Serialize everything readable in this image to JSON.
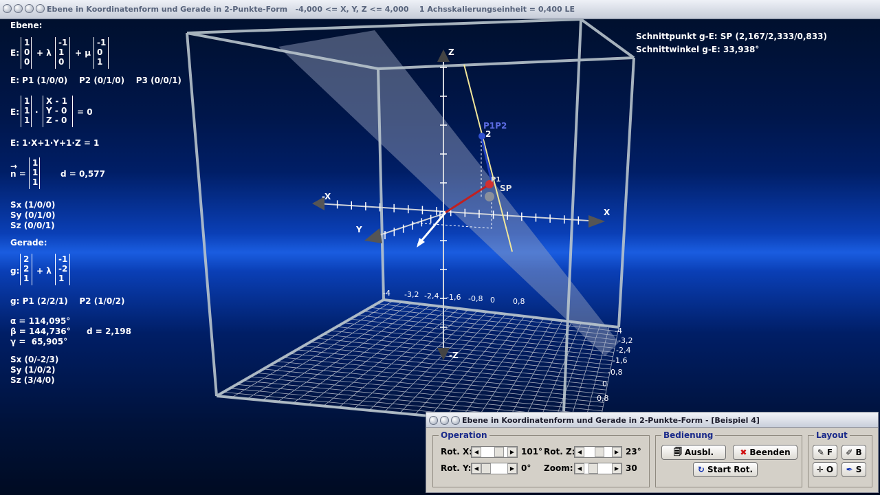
{
  "window": {
    "title": "Ebene in Koordinatenform und Gerade in 2-Punkte-Form   -4,000 <= X, Y, Z <= 4,000    1 Achsskalierungseinheit = 0,400 LE"
  },
  "left_info": {
    "ebene_heading": "Ebene:",
    "e_prefix": "E:",
    "e_vec1": [
      "1",
      "0",
      "0"
    ],
    "plus_lambda": "+ λ",
    "e_vec2": [
      "-1",
      "1",
      "0"
    ],
    "plus_mu": "+ μ",
    "e_vec3": [
      "-1",
      "0",
      "1"
    ],
    "e_points": "E: P1 (1/0/0)    P2 (0/1/0)    P3 (0/0/1)",
    "e_normal_vec": [
      "1",
      "1",
      "1"
    ],
    "dot": "·",
    "e_xyz_vec": [
      "X - 1",
      "Y - 0",
      "Z - 0"
    ],
    "eq_zero": "= 0",
    "e_coord": "E: 1·X+1·Y+1·Z = 1",
    "n_arrow": "→",
    "n_label": "n =",
    "n_vec": [
      "1",
      "1",
      "1"
    ],
    "d_plane": "d = 0,577",
    "sx": "Sx (1/0/0)",
    "sy": "Sy (0/1/0)",
    "sz": "Sz (0/0/1)",
    "gerade_heading": "Gerade:",
    "g_prefix": "g:",
    "g_vec1": [
      "2",
      "2",
      "1"
    ],
    "g_plus_lambda": "+ λ",
    "g_vec2": [
      "-1",
      "-2",
      "1"
    ],
    "g_points": "g: P1 (2/2/1)    P2 (1/0/2)",
    "alpha": "α = 114,095°",
    "beta": "β = 144,736°",
    "gamma": "γ =  65,905°",
    "d_line": "d = 2,198",
    "gsx": "Sx (0/-2/3)",
    "gsy": "Sy (1/0/2)",
    "gsz": "Sz (3/4/0)"
  },
  "right_info": {
    "schnittpunkt": "Schnittpunkt g-E: SP (2,167/2,333/0,833)",
    "schnittwinkel": "Schnittwinkel g-E: 33,938°"
  },
  "scene_labels": {
    "z": "Z",
    "neg_z": "-Z",
    "x": "X",
    "neg_x": "-X",
    "y": "Y",
    "p1p2": "P1P2",
    "two": "2",
    "p1": "P1",
    "sp": "SP",
    "back_ticks": [
      "-4",
      "-3,2",
      "-2,4",
      "-1,6",
      "-0,8",
      "0",
      "0,8"
    ],
    "right_ticks": [
      "-4",
      "-3,2",
      "-2,4",
      "-1,6",
      "-0,8",
      "0",
      "0,8"
    ]
  },
  "panel": {
    "title": "Ebene in Koordinatenform und Gerade in 2-Punkte-Form - [Beispiel 4]",
    "operation_label": "Operation",
    "rot_x_label": "Rot. X:",
    "rot_x_value": "101°",
    "rot_y_label": "Rot. Y:",
    "rot_y_value": "0°",
    "rot_z_label": "Rot. Z:",
    "rot_z_value": "23°",
    "zoom_label": "Zoom:",
    "zoom_value": "30",
    "bedienung_label": "Bedienung",
    "ausbl_label": "Ausbl.",
    "beenden_label": "Beenden",
    "start_rot_label": "Start Rot.",
    "layout_label": "Layout",
    "layout_f": "F",
    "layout_b": "B",
    "layout_o": "O",
    "layout_s": "S",
    "arrow_left": "◀",
    "arrow_right": "▶"
  },
  "colors": {
    "line_g": "#f0e69a",
    "normal": "#2040c0",
    "plane": "#9aa4c0",
    "cube": "#b8c4cc"
  }
}
